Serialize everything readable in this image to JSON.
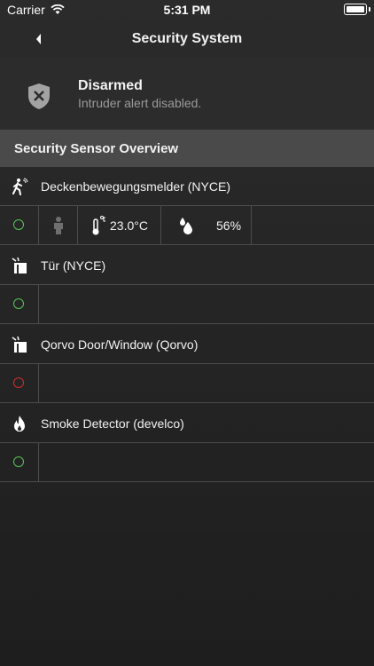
{
  "status_bar": {
    "carrier": "Carrier",
    "time": "5:31 PM"
  },
  "nav": {
    "title": "Security System"
  },
  "security_status": {
    "title": "Disarmed",
    "subtitle": "Intruder alert disabled."
  },
  "section": {
    "title": "Security Sensor Overview"
  },
  "sensors": [
    {
      "name": "Deckenbewegungsmelder (NYCE)",
      "icon": "motion-walker-icon",
      "status": "ok",
      "temperature": "23.0°C",
      "humidity": "56%"
    },
    {
      "name": "Tür (NYCE)",
      "icon": "door-window-icon",
      "status": "ok"
    },
    {
      "name": "Qorvo Door/Window (Qorvo)",
      "icon": "door-window-icon",
      "status": "alert"
    },
    {
      "name": "Smoke Detector (develco)",
      "icon": "flame-icon",
      "status": "ok"
    }
  ],
  "colors": {
    "ok": "#59c45a",
    "alert": "#d0302e",
    "section_header": "#4a4a4a"
  }
}
